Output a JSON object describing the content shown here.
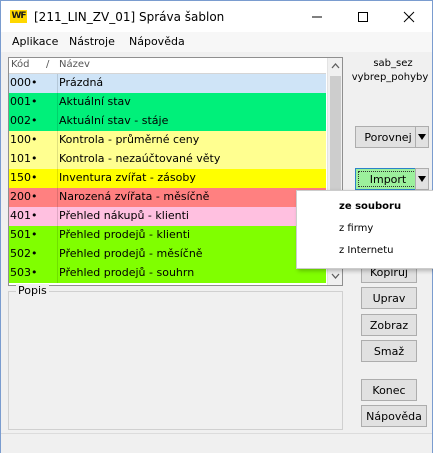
{
  "window": {
    "logo_text": "WF",
    "title": "[211_LIN_ZV_01] Správa šablon",
    "logo_color": "#ffd800"
  },
  "menu": [
    "Aplikace",
    "Nástroje",
    "Nápověda"
  ],
  "grid": {
    "columns": {
      "code": "Kód",
      "sort": "/",
      "name": "Název"
    },
    "rows": [
      {
        "code": "000•",
        "name": "Prázdná",
        "color": "#cfe4f7"
      },
      {
        "code": "001•",
        "name": "Aktuální stav",
        "color": "#00f07a"
      },
      {
        "code": "002•",
        "name": "Aktuální stav - stáje",
        "color": "#00f07a"
      },
      {
        "code": "100•",
        "name": "Kontrola - průměrné ceny",
        "color": "#ffff90"
      },
      {
        "code": "101•",
        "name": "Kontrola - nezaúčtované věty",
        "color": "#ffff90"
      },
      {
        "code": "150•",
        "name": "Inventura zvířat - zásoby",
        "color": "#ffff00"
      },
      {
        "code": "200•",
        "name": "Narozená zvířata - měsíčně",
        "color": "#ff8080"
      },
      {
        "code": "401•",
        "name": "Přehled nákupů - klienti",
        "color": "#ffc0e0"
      },
      {
        "code": "501•",
        "name": "Přehled prodejů - klienti",
        "color": "#80ff00"
      },
      {
        "code": "502•",
        "name": "Přehled prodejů - měsíčně",
        "color": "#80ff00"
      },
      {
        "code": "503•",
        "name": "Přehled prodejů - souhrn",
        "color": "#80ff00"
      }
    ]
  },
  "popis_label": "Popis",
  "sidebar": {
    "label_line1": "sab_sez",
    "label_line2": "vybrep_pohyby",
    "porovnej": "Porovnej",
    "import": "Import",
    "kopiruj": "Kopíruj",
    "uprav": "Uprav",
    "zobraz": "Zobraz",
    "smaz": "Smaž",
    "konec": "Konec",
    "napoveda": "Nápověda"
  },
  "import_menu": [
    "ze souboru",
    "z firmy",
    "z Internetu"
  ]
}
